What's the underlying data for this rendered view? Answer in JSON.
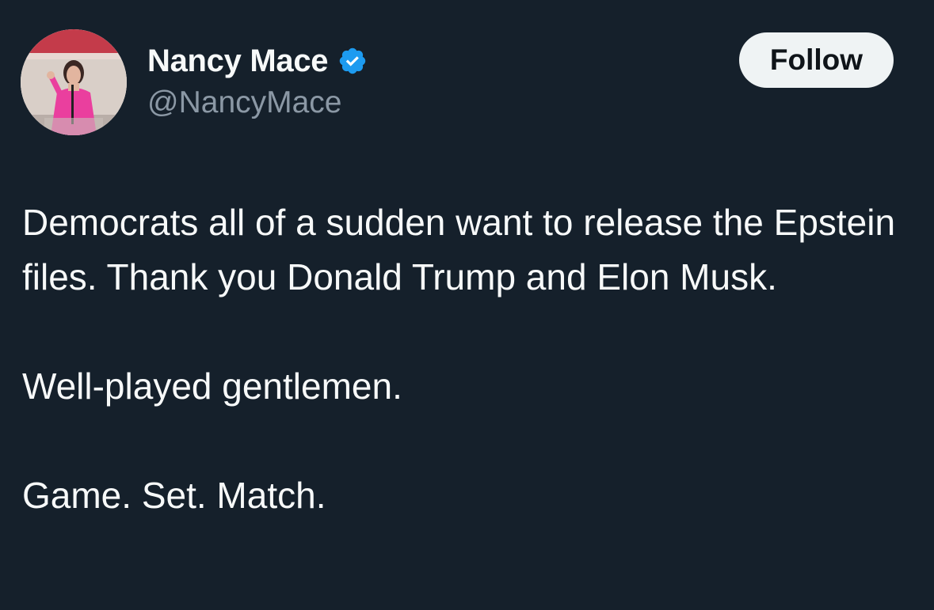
{
  "tweet": {
    "author": {
      "display_name": "Nancy Mace",
      "handle": "@NancyMace",
      "verified": true,
      "avatar_icon": "profile-photo"
    },
    "follow_label": "Follow",
    "paragraphs": [
      "Democrats all of a sudden want to release the Epstein files. Thank you Donald Trump and Elon Musk.",
      "Well-played gentlemen.",
      "Game. Set. Match."
    ]
  },
  "colors": {
    "background": "#15202b",
    "text": "#f7f9f9",
    "secondary_text": "#8b98a5",
    "verified_badge": "#1d9bf0",
    "follow_button_bg": "#eff3f4"
  }
}
